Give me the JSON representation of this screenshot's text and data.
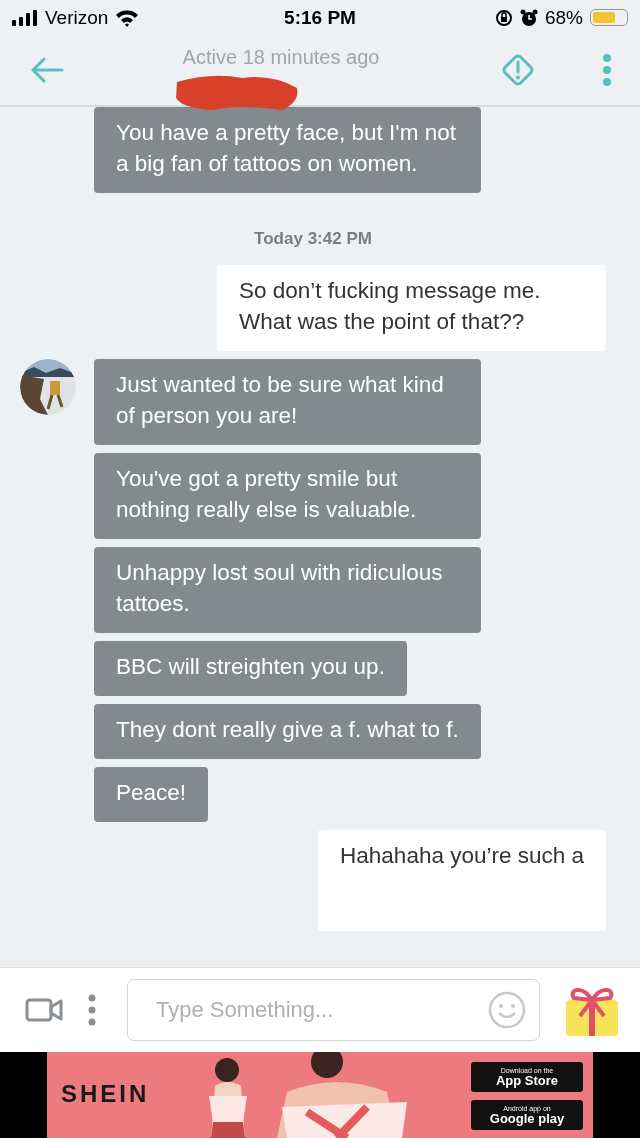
{
  "status_bar": {
    "carrier": "Verizon",
    "time": "5:16 PM",
    "battery": "68%"
  },
  "header": {
    "subtitle": "Active 18 minutes ago"
  },
  "messages": [
    {
      "kind": "incoming",
      "text": "You have a pretty face, but I'm not a big fan of tattoos on women.",
      "avatar": false
    },
    {
      "kind": "timestamp",
      "text": "Today 3:42 PM"
    },
    {
      "kind": "outgoing",
      "text": "So don’t fucking message me. What was the point of that??"
    },
    {
      "kind": "incoming",
      "text": "Just wanted to be sure what kind of person you are!",
      "avatar": true
    },
    {
      "kind": "incoming",
      "text": "You've got a pretty smile but nothing really else is valuable.",
      "avatar": false
    },
    {
      "kind": "incoming",
      "text": "Unhappy lost soul with ridiculous tattoes.",
      "avatar": false
    },
    {
      "kind": "incoming",
      "text": "BBC will streighten you up.",
      "avatar": false
    },
    {
      "kind": "incoming",
      "text": "They dont really give a f. what to f.",
      "avatar": false
    },
    {
      "kind": "incoming",
      "text": "Peace!",
      "avatar": false
    },
    {
      "kind": "outgoing",
      "text": "Hahahaha you’re such a"
    }
  ],
  "composer": {
    "placeholder": "Type Something..."
  },
  "ad": {
    "logo": "SHEIN",
    "badges": [
      {
        "small": "Download on the",
        "big": "App Store"
      },
      {
        "small": "Android app on",
        "big": "Google play"
      }
    ]
  }
}
